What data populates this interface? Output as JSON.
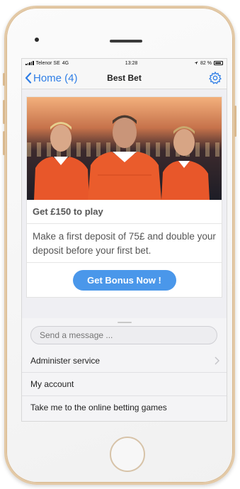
{
  "status_bar": {
    "carrier": "Telenor SE",
    "network": "4G",
    "time": "13:28",
    "battery": "82 %"
  },
  "nav": {
    "back_label": "Home (4)",
    "title": "Best Bet"
  },
  "promo": {
    "title": "Get £150 to play",
    "description": "Make a first deposit of 75£ and double your deposit before your first bet.",
    "button_label": "Get Bonus Now !"
  },
  "composer": {
    "placeholder": "Send a message ..."
  },
  "menu": {
    "items": [
      {
        "label": "Administer service"
      },
      {
        "label": "My account"
      },
      {
        "label": "Take me to the online betting games"
      }
    ]
  },
  "colors": {
    "accent": "#4a97ea",
    "link": "#2f7ee6",
    "phone_frame": "#e3c9a6",
    "jersey": "#e8572a"
  },
  "icons": [
    "back-chevron-icon",
    "gear-icon",
    "chevron-right-icon"
  ]
}
